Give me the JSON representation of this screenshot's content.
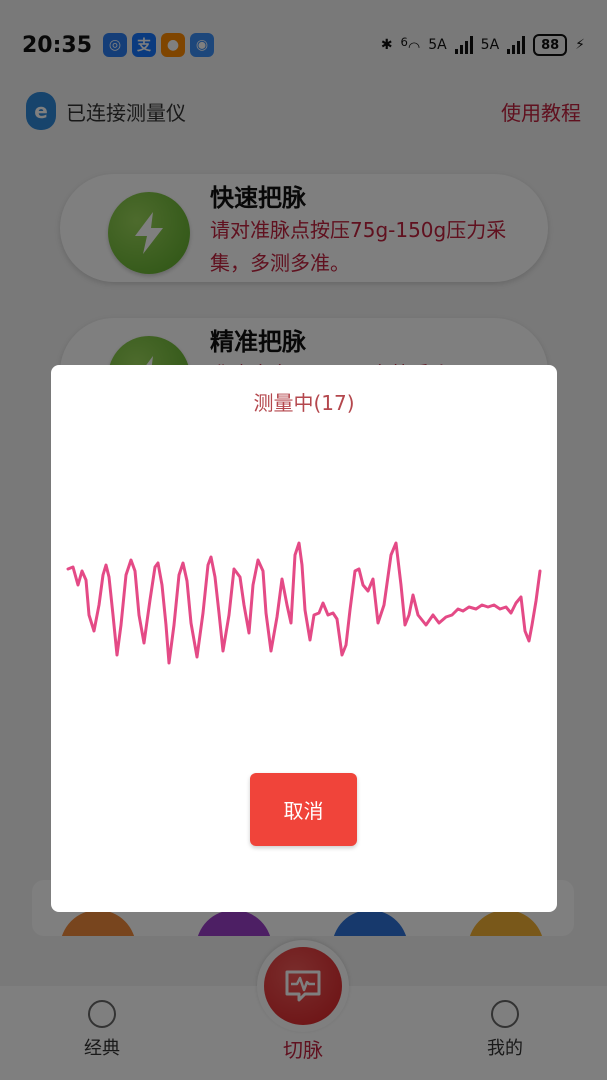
{
  "status_bar": {
    "time": "20:35",
    "app_icons": [
      {
        "name": "bulb-app-icon",
        "color": "#2a7df0",
        "glyph": "◎"
      },
      {
        "name": "alipay-app-icon",
        "color": "#1677ff",
        "glyph": "支"
      },
      {
        "name": "taobao-app-icon",
        "color": "#ff8a00",
        "glyph": "●"
      },
      {
        "name": "wifi-app-icon",
        "color": "#3a8ef6",
        "glyph": "◉"
      }
    ],
    "network_1": "5A",
    "network_2": "5A",
    "wifi_badge": "6",
    "battery": "88"
  },
  "header": {
    "device_icon_glyph": "e",
    "device_status": "已连接测量仪",
    "tutorial": "使用教程"
  },
  "cards": [
    {
      "title": "快速把脉",
      "desc": "请对准脉点按压75g-150g压力采集，多测多准。"
    },
    {
      "title": "精准把脉",
      "desc": "准确度高，需要用户熟悉脉"
    }
  ],
  "quick_colors": [
    "#f08a3c",
    "#9b3fc8",
    "#2f73d8",
    "#f2b134"
  ],
  "dialog": {
    "title": "测量中(17)",
    "cancel_label": "取消",
    "wave_color": "#e44a86"
  },
  "bottom_nav": {
    "items": [
      {
        "label": "经典"
      },
      {
        "label": "切脉"
      },
      {
        "label": "我的"
      }
    ]
  }
}
